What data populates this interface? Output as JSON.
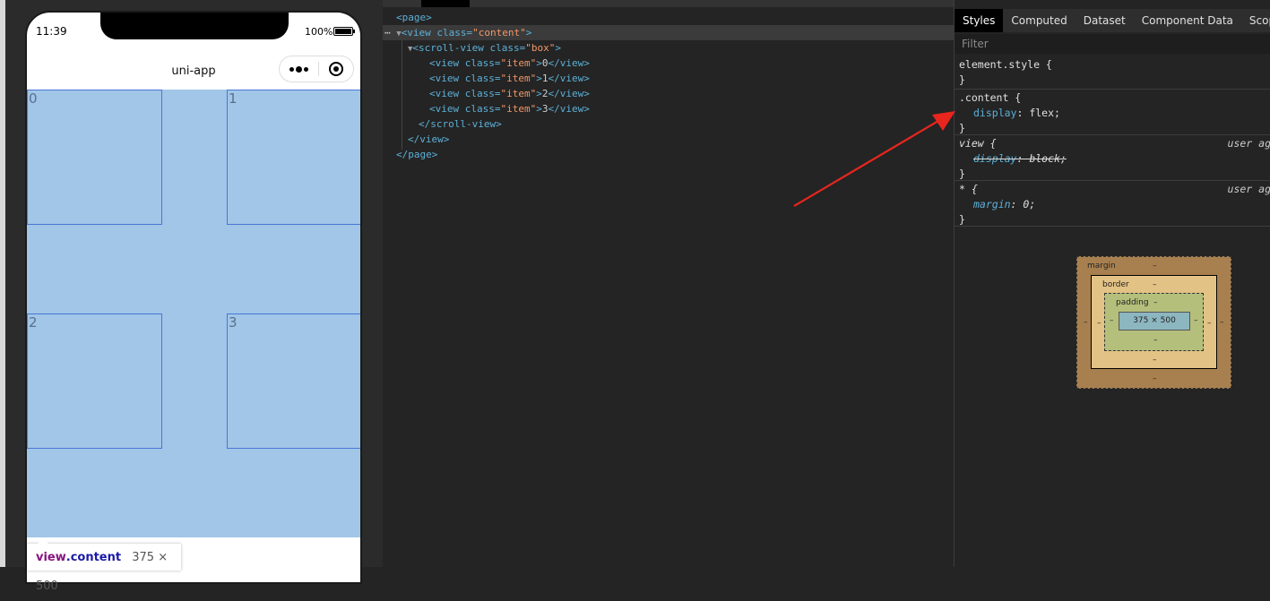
{
  "simulator": {
    "status_time": "11:39",
    "battery_percent": "100%",
    "nav_title": "uni-app",
    "items": [
      "0",
      "1",
      "2",
      "3"
    ],
    "tooltip": {
      "element": "view",
      "class": ".content",
      "size": "375 × 500"
    }
  },
  "elements_tree": [
    {
      "indent": 0,
      "open": "<page>",
      "tag": "page",
      "cls": "",
      "text": ""
    },
    {
      "indent": 1,
      "tag": "view",
      "cls": "content",
      "selected": true
    },
    {
      "indent": 2,
      "tag": "scroll-view",
      "cls": "box"
    },
    {
      "indent": 3,
      "tag": "view",
      "cls": "item",
      "text": "0"
    },
    {
      "indent": 3,
      "tag": "view",
      "cls": "item",
      "text": "1"
    },
    {
      "indent": 3,
      "tag": "view",
      "cls": "item",
      "text": "2"
    },
    {
      "indent": 3,
      "tag": "view",
      "cls": "item",
      "text": "3"
    }
  ],
  "elements_text": {
    "page_open": "<page>",
    "scroll_close": "</scroll-view>",
    "view_close": "</view>",
    "page_close": "</page>",
    "view_open": "<view class=",
    "content_val": "\"content\"",
    "scroll_open": "<scroll-view class=",
    "box_val": "\"box\"",
    "item_open": "<view class=",
    "item_val": "\"item\"",
    "item_close": "</view>"
  },
  "styles_panel": {
    "tabs": [
      "Styles",
      "Computed",
      "Dataset",
      "Component Data",
      "Scope Da"
    ],
    "filter_placeholder": "Filter",
    "rules": {
      "element_style": "element.style {",
      "close": "}",
      "content_selector": ".content {",
      "content_prop": "display",
      "content_val": "flex;",
      "view_selector": "view {",
      "view_prop": "display",
      "view_val": "block;",
      "view_source": "user ag",
      "star_selector": "* {",
      "star_prop": "margin",
      "star_val": "0;",
      "star_source": "user ag"
    },
    "box_model": {
      "margin_label": "margin",
      "border_label": "border",
      "padding_label": "padding",
      "content_size": "375 × 500",
      "dash": "–"
    }
  },
  "colors": {
    "highlight_fill": "#a1c6e7",
    "item_border": "#4a76d6",
    "annotation_arrow": "#e8261e"
  }
}
